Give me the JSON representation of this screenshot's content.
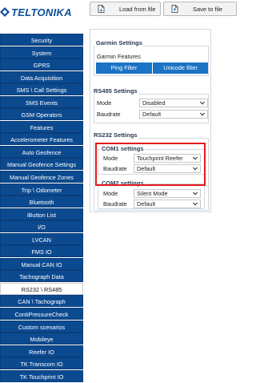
{
  "brand": {
    "name": "TELTONIKA",
    "color": "#0d4f9c"
  },
  "toolbar": {
    "load_label": "Load from file",
    "save_label": "Save to file",
    "load_icon": "file-open-icon",
    "save_icon": "save-disk-icon"
  },
  "sidebar": {
    "items": [
      "Security",
      "System",
      "GPRS",
      "Data Acquisition",
      "SMS \\ Call Settings",
      "SMS Events",
      "GSM Operators",
      "Features",
      "Accelerometer Features",
      "Auto Geofence",
      "Manual Geofence Settings",
      "Manual Geofence Zones",
      "Trip \\ Odometer",
      "Bluetooth",
      "iButton List",
      "I/O",
      "LVCAN",
      "FMS IO",
      "Manual CAN IO",
      "Tachograph Data",
      "RS232 \\ RS485",
      "CAN \\ Tachograph",
      "ContiPressureCheck",
      "Custom scenarios",
      "Mobileye",
      "Reefer IO",
      "TK Transcom IO",
      "TK Touchprint IO"
    ],
    "active_index": 20
  },
  "garmin": {
    "title": "Garmin Settings",
    "subtitle": "Garmin Features",
    "ping_filter": "Ping Filter",
    "unicode_filter": "Unicode filter"
  },
  "rs485": {
    "title": "RS485 Settings",
    "mode_label": "Mode",
    "mode_value": "Disabled",
    "baud_label": "Baudrate",
    "baud_value": "Default"
  },
  "rs232": {
    "title": "RS232 Settings",
    "com1": {
      "title": "COM1 settings",
      "mode_label": "Mode",
      "mode_value": "Touchprint Reefer",
      "baud_label": "Baudrate",
      "baud_value": "Default"
    },
    "com2": {
      "title": "COM2 settings",
      "mode_label": "Mode",
      "mode_value": "Silent Mode",
      "baud_label": "Baudrate",
      "baud_value": "Default"
    }
  },
  "colors": {
    "sidebar_bg": "#0c4a90",
    "button_blue": "#1a73c5",
    "highlight_red": "#e31b1b"
  }
}
